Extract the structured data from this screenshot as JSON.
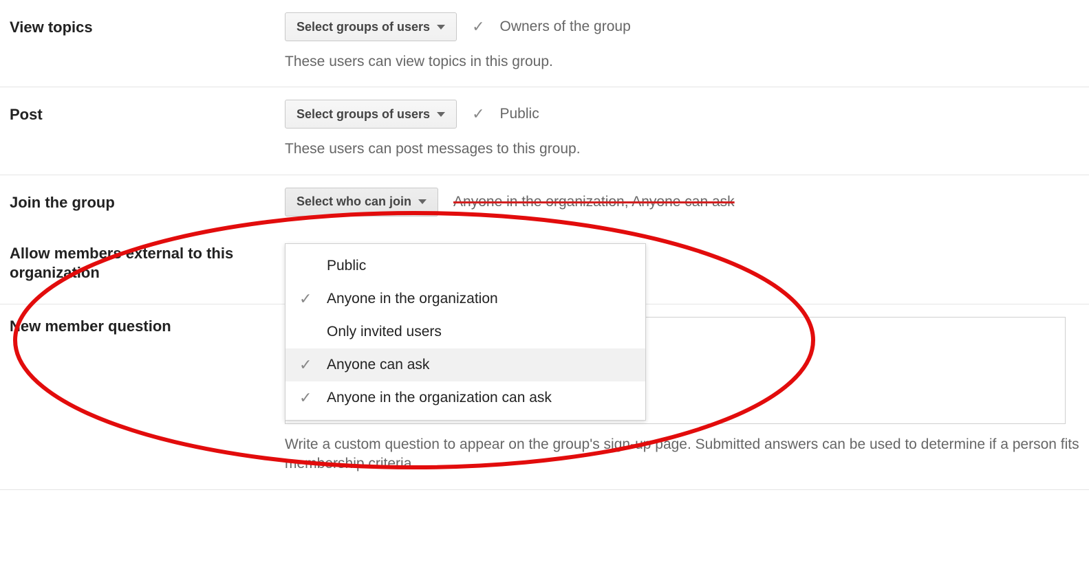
{
  "rows": {
    "view_topics": {
      "label": "View topics",
      "button": "Select groups of users",
      "summary": "Owners of the group",
      "desc": "These users can view topics in this group."
    },
    "post": {
      "label": "Post",
      "button": "Select groups of users",
      "summary": "Public",
      "desc": "These users can post messages to this group."
    },
    "join": {
      "label": "Join the group",
      "button": "Select who can join",
      "summary": "Anyone in the organization, Anyone can ask"
    },
    "allow_external": {
      "label": "Allow members external to this organization"
    },
    "new_member_question": {
      "label": "New member question",
      "desc": "Write a custom question to appear on the group's sign-up page. Submitted answers can be used to determine if a person fits membership criteria."
    }
  },
  "menu": {
    "items": [
      {
        "label": "Public",
        "checked": false
      },
      {
        "label": "Anyone in the organization",
        "checked": true
      },
      {
        "label": "Only invited users",
        "checked": false
      },
      {
        "label": "Anyone can ask",
        "checked": true,
        "hover": true
      },
      {
        "label": "Anyone in the organization can ask",
        "checked": true
      }
    ]
  }
}
